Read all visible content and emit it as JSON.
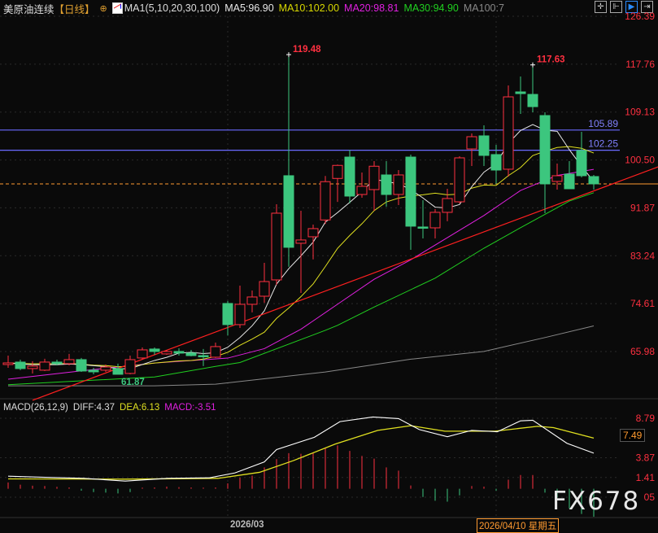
{
  "header": {
    "title": "美原油连续",
    "period": "【日线】",
    "period_icon": "target-icon",
    "ma_label": "MA1(5,10,20,30,100)",
    "ma5": "MA5:96.90",
    "ma10": "MA10:102.00",
    "ma20": "MA20:98.81",
    "ma30": "MA30:94.90",
    "ma100": "MA100:7"
  },
  "toolbar": {
    "icons": [
      "crosshair-icon",
      "range-icon",
      "play-icon",
      "exit-icon"
    ]
  },
  "colors": {
    "up": "#ff3040",
    "down": "#3cc67e",
    "ma5": "#e8e8e8",
    "ma10": "#e0e020",
    "ma20": "#e020e0",
    "ma30": "#20d020",
    "ma100": "#888888",
    "hline": "#6a6aff",
    "trend": "#ff2020",
    "current": "#ff9a30",
    "diff": "#ffffff",
    "dea": "#e0e020",
    "macd": "#e020e0"
  },
  "price_axis": [
    "126.39",
    "117.76",
    "109.13",
    "100.50",
    "91.87",
    "83.24",
    "74.61",
    "65.98"
  ],
  "macd_axis": [
    "8.79",
    "3.87",
    "1.41",
    "05"
  ],
  "macd_box": "7.49",
  "chart_data": {
    "type": "candlestick",
    "ylim": [
      65.98,
      126.39
    ],
    "ohlc": [
      [
        63.64,
        63.93,
        65.25,
        63.05
      ],
      [
        64.08,
        62.91,
        64.52,
        62.62
      ],
      [
        62.91,
        63.35,
        64.23,
        62.03
      ],
      [
        62.62,
        64.08,
        64.67,
        62.47
      ],
      [
        64.08,
        63.79,
        64.52,
        63.49
      ],
      [
        63.79,
        64.52,
        65.55,
        63.49
      ],
      [
        64.52,
        62.47,
        64.82,
        62.32
      ],
      [
        62.62,
        62.32,
        63.05,
        61.88
      ],
      [
        62.62,
        63.2,
        63.64,
        62.32
      ],
      [
        62.91,
        61.88,
        63.79,
        61.87
      ],
      [
        62.03,
        64.52,
        65.25,
        61.88
      ],
      [
        64.82,
        66.28,
        66.72,
        64.52
      ],
      [
        66.43,
        65.99,
        66.72,
        65.4
      ],
      [
        65.55,
        65.99,
        66.28,
        65.4
      ],
      [
        65.99,
        65.7,
        66.57,
        65.25
      ],
      [
        65.7,
        65.25,
        66.28,
        65.11
      ],
      [
        65.25,
        65.11,
        66.43,
        63.35
      ],
      [
        64.96,
        66.87,
        67.6,
        64.82
      ],
      [
        74.64,
        70.83,
        75.08,
        68.86
      ],
      [
        70.83,
        74.49,
        77.86,
        70.24
      ],
      [
        74.49,
        75.81,
        76.98,
        73.03
      ],
      [
        75.95,
        78.59,
        81.96,
        74.76
      ],
      [
        78.89,
        90.91,
        92.52,
        77.98
      ],
      [
        97.66,
        84.76,
        119.48,
        81.24
      ],
      [
        85.49,
        86.08,
        91.35,
        76.54
      ],
      [
        86.66,
        88.13,
        88.86,
        82.58
      ],
      [
        89.69,
        96.59,
        97.61,
        88.96
      ],
      [
        97.17,
        99.52,
        99.66,
        92.94
      ],
      [
        101.02,
        93.99,
        102.35,
        92.67
      ],
      [
        94.28,
        95.75,
        98.24,
        93.7
      ],
      [
        95.16,
        99.37,
        100.29,
        91.35
      ],
      [
        97.8,
        94.28,
        100.29,
        92.08
      ],
      [
        94.28,
        97.8,
        98.68,
        92.38
      ],
      [
        101.02,
        88.57,
        101.47,
        84.31
      ],
      [
        88.42,
        88.27,
        93.26,
        86.37
      ],
      [
        88.27,
        91.06,
        91.64,
        86.37
      ],
      [
        91.06,
        93.55,
        95.31,
        89.45
      ],
      [
        92.96,
        100.88,
        101.17,
        92.67
      ],
      [
        102.49,
        104.69,
        105.28,
        99.41
      ],
      [
        104.84,
        101.32,
        106.74,
        99.41
      ],
      [
        101.47,
        98.68,
        103.23,
        96.19
      ],
      [
        98.83,
        111.87,
        113.93,
        97.51
      ],
      [
        112.76,
        112.46,
        115.54,
        108.8
      ],
      [
        112.31,
        110.11,
        117.63,
        109.09
      ],
      [
        108.5,
        96.19,
        109.09,
        90.91
      ],
      [
        96.63,
        97.66,
        99.85,
        95.16
      ],
      [
        97.95,
        95.31,
        100.29,
        95.31
      ],
      [
        102.2,
        97.66,
        105.57,
        97.36
      ],
      [
        97.51,
        96.19,
        97.8,
        95.16
      ]
    ],
    "ma20": [
      [
        0,
        61.0
      ],
      [
        6,
        62.5
      ],
      [
        12,
        63.9
      ],
      [
        18,
        64.8
      ],
      [
        21,
        66.5
      ],
      [
        24,
        70.0
      ],
      [
        27,
        74.5
      ],
      [
        30,
        79.0
      ],
      [
        33,
        82.5
      ],
      [
        36,
        86.5
      ],
      [
        39,
        90.5
      ],
      [
        42,
        95.0
      ],
      [
        45,
        97.7
      ],
      [
        48,
        98.8
      ]
    ],
    "ma30": [
      [
        0,
        60.0
      ],
      [
        12,
        61.4
      ],
      [
        17,
        63.3
      ],
      [
        19,
        64.0
      ],
      [
        26,
        69.8
      ],
      [
        27,
        70.7
      ],
      [
        30,
        74.0
      ],
      [
        35,
        79.2
      ],
      [
        39,
        84.6
      ],
      [
        42,
        88.3
      ],
      [
        46,
        93.1
      ],
      [
        48,
        94.6
      ]
    ],
    "ma100": [
      [
        0,
        59.8
      ],
      [
        12,
        59.8
      ],
      [
        17,
        60.1
      ],
      [
        26,
        62.3
      ],
      [
        33,
        64.6
      ],
      [
        39,
        66.0
      ],
      [
        44,
        68.5
      ],
      [
        48,
        70.6
      ]
    ],
    "hlines": [
      {
        "value": 105.89,
        "label": "105.89"
      },
      {
        "value": 102.25,
        "label": "102.25"
      }
    ],
    "current_price": 96.19,
    "trendline": [
      [
        2,
        57.2
      ],
      [
        53.3,
        99.27
      ]
    ],
    "annotations": [
      {
        "index": 23,
        "value": 119.48,
        "label": "119.48"
      },
      {
        "index": 43,
        "value": 117.63,
        "label": "117.63"
      },
      {
        "index": 9,
        "value": 61.87,
        "label": "61.87"
      }
    ],
    "x_labels": [
      {
        "index": 20,
        "label": "2026/03"
      },
      {
        "index": 40,
        "label": "2026/04/10 星期五"
      }
    ],
    "macd": {
      "title": "MACD(26,12,9)",
      "diff_label": "DIFF:4.37",
      "dea_label": "DEA:6.13",
      "macd_label": "MACD:-3.51",
      "ylim": [
        -1.05,
        8.79
      ],
      "hist": [
        0.79,
        0.51,
        0.38,
        0.34,
        0.24,
        0.17,
        -0.24,
        -0.41,
        -0.48,
        -0.58,
        -0.41,
        0.14,
        0.17,
        0.27,
        0.2,
        0.17,
        0.14,
        0.17,
        0.68,
        1.37,
        1.64,
        2.67,
        3.69,
        4.44,
        4.37,
        4.44,
        5.06,
        5.4,
        4.72,
        4.1,
        3.76,
        2.67,
        2.26,
        0.41,
        -1.03,
        -1.5,
        -1.61,
        -0.82,
        0.34,
        0.27,
        -0.24,
        1.13,
        1.71,
        1.71,
        -0.48,
        -1.09,
        -2.46,
        -3.14,
        -3.49
      ],
      "diff": [
        [
          0,
          1.57
        ],
        [
          2.75,
          1.44
        ],
        [
          6.2,
          1.3
        ],
        [
          9.6,
          0.96
        ],
        [
          13.1,
          1.3
        ],
        [
          16.5,
          1.37
        ],
        [
          18.6,
          1.98
        ],
        [
          21,
          3.35
        ],
        [
          22,
          4.89
        ],
        [
          25.1,
          6.42
        ],
        [
          27.2,
          8.37
        ],
        [
          29.9,
          8.95
        ],
        [
          32,
          8.75
        ],
        [
          33.7,
          7.38
        ],
        [
          36,
          6.49
        ],
        [
          38,
          7.28
        ],
        [
          40.1,
          7.11
        ],
        [
          42,
          8.47
        ],
        [
          43,
          8.54
        ],
        [
          45.8,
          5.67
        ],
        [
          48,
          4.44
        ]
      ],
      "dea": [
        [
          0,
          1.23
        ],
        [
          9.6,
          1.2
        ],
        [
          17.2,
          1.3
        ],
        [
          20.6,
          2.05
        ],
        [
          23.4,
          3.52
        ],
        [
          26.8,
          5.57
        ],
        [
          30.3,
          7.28
        ],
        [
          33,
          7.86
        ],
        [
          35.8,
          7.18
        ],
        [
          39.9,
          7.18
        ],
        [
          43.4,
          7.79
        ],
        [
          44.7,
          7.62
        ],
        [
          48,
          6.32
        ]
      ]
    }
  },
  "watermark": "FX678"
}
